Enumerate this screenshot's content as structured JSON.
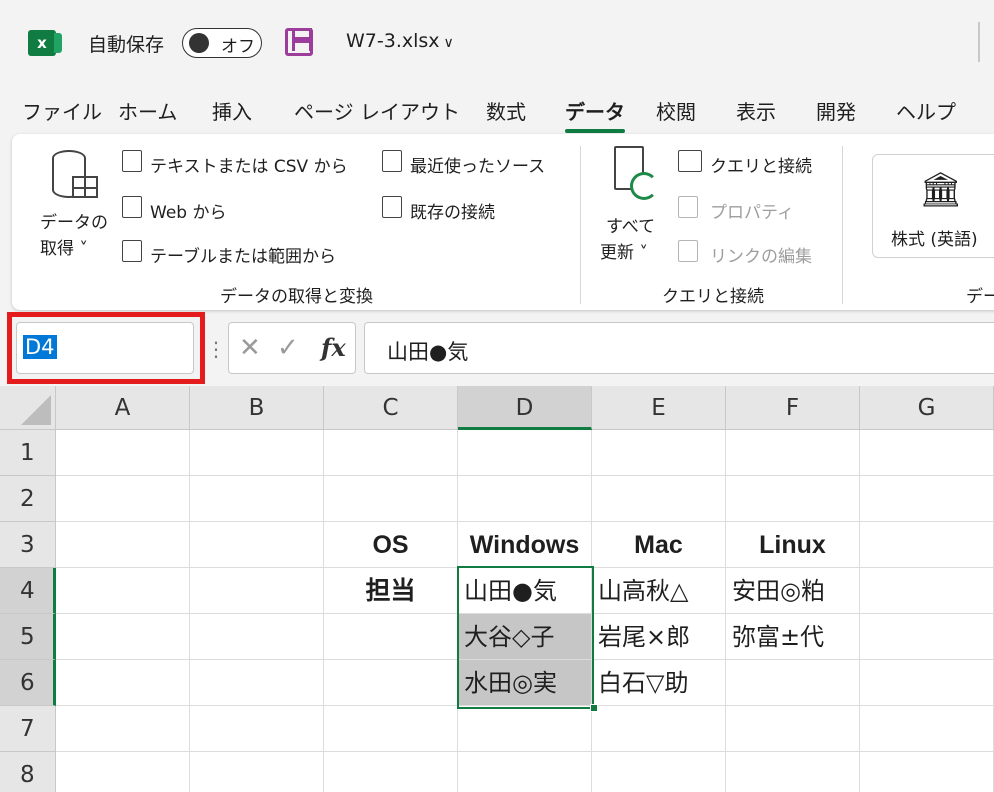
{
  "titlebar": {
    "app_icon": "excel-icon",
    "autosave_label": "自動保存",
    "autosave_state": "オフ",
    "save_icon": "save-icon",
    "filename": "W7-3.xlsx",
    "filename_chevron": "∨"
  },
  "menu": {
    "tabs": [
      "ファイル",
      "ホーム",
      "挿入",
      "ページ レイアウト",
      "数式",
      "データ",
      "校閲",
      "表示",
      "開発",
      "ヘルプ"
    ],
    "active": "データ"
  },
  "ribbon": {
    "get_data": {
      "label_line1": "データの",
      "label_line2": "取得 ˅"
    },
    "text_csv": "テキストまたは CSV から",
    "web": "Web から",
    "table_range": "テーブルまたは範囲から",
    "recent_sources": "最近使ったソース",
    "existing_connections": "既存の接続",
    "group1_label": "データの取得と変換",
    "refresh_all": {
      "label_line1": "すべて",
      "label_line2": "更新 ˅"
    },
    "queries_connections": "クエリと接続",
    "properties": "プロパティ",
    "edit_links": "リンクの編集",
    "group2_label": "クエリと接続",
    "stocks": "株式 (英語)",
    "group3_label_partial": "デー"
  },
  "formula_bar": {
    "name_box": "D4",
    "cancel_symbol": "✕",
    "enter_symbol": "✓",
    "fx_symbol": "fx",
    "content": "山田●気"
  },
  "sheet": {
    "columns": [
      "A",
      "B",
      "C",
      "D",
      "E",
      "F",
      "G"
    ],
    "rows": [
      "1",
      "2",
      "3",
      "4",
      "5",
      "6",
      "7",
      "8"
    ],
    "selected_column": "D",
    "selected_rows": [
      "4"
    ],
    "cells": {
      "C3": "OS",
      "D3": "Windows",
      "E3": "Mac",
      "F3": "Linux",
      "C4": "担当",
      "D4": "山田●気",
      "E4": "山高秋△",
      "F4": "安田◎粕",
      "D5": "大谷◇子",
      "E5": "岩尾×郎",
      "F5": "弥富±代",
      "D6": "水田◎実",
      "E6": "白石▽助"
    },
    "selection_range": "D4:D6",
    "accent_color": "#107c41",
    "highlight_color": "#e51c1c"
  }
}
